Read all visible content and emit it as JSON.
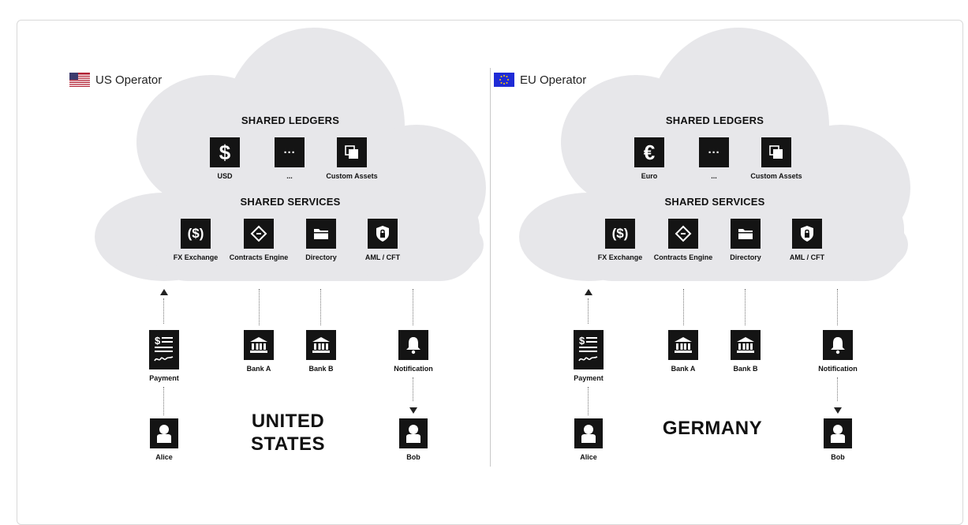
{
  "panels": [
    {
      "operator": "US Operator",
      "flag": "us-flag",
      "ledgers_title": "SHARED LEDGERS",
      "ledgers": [
        {
          "symbol": "$",
          "label": "USD",
          "icon": "dollar-icon"
        },
        {
          "symbol": "···",
          "label": "...",
          "icon": "more-icon"
        },
        {
          "symbol": "",
          "label": "Custom Assets",
          "icon": "custom-assets-icon"
        }
      ],
      "services_title": "SHARED SERVICES",
      "services": [
        {
          "symbol": "($)",
          "label": "FX Exchange",
          "icon": "fx-exchange-icon"
        },
        {
          "symbol": "",
          "label": "Contracts Engine",
          "icon": "contracts-engine-icon"
        },
        {
          "symbol": "",
          "label": "Directory",
          "icon": "folder-icon"
        },
        {
          "symbol": "",
          "label": "AML / CFT",
          "icon": "shield-icon"
        }
      ],
      "participants": {
        "payment": "Payment",
        "bank_a": "Bank A",
        "bank_b": "Bank B",
        "notification": "Notification",
        "alice": "Alice",
        "bob": "Bob"
      },
      "country_line1": "UNITED",
      "country_line2": "STATES"
    },
    {
      "operator": "EU Operator",
      "flag": "eu-flag",
      "ledgers_title": "SHARED LEDGERS",
      "ledgers": [
        {
          "symbol": "€",
          "label": "Euro",
          "icon": "euro-icon"
        },
        {
          "symbol": "···",
          "label": "...",
          "icon": "more-icon"
        },
        {
          "symbol": "",
          "label": "Custom Assets",
          "icon": "custom-assets-icon"
        }
      ],
      "services_title": "SHARED SERVICES",
      "services": [
        {
          "symbol": "($)",
          "label": "FX Exchange",
          "icon": "fx-exchange-icon"
        },
        {
          "symbol": "",
          "label": "Contracts Engine",
          "icon": "contracts-engine-icon"
        },
        {
          "symbol": "",
          "label": "Directory",
          "icon": "folder-icon"
        },
        {
          "symbol": "",
          "label": "AML / CFT",
          "icon": "shield-icon"
        }
      ],
      "participants": {
        "payment": "Payment",
        "bank_a": "Bank A",
        "bank_b": "Bank B",
        "notification": "Notification",
        "alice": "Alice",
        "bob": "Bob"
      },
      "country_line1": "GERMANY",
      "country_line2": ""
    }
  ],
  "colors": {
    "cloud": "#e7e7ea",
    "icon_box": "#141414",
    "us_blue": "#3c3b6e",
    "us_red": "#b22234",
    "eu_blue": "#1f2bd6",
    "eu_star": "#ffcc00"
  }
}
